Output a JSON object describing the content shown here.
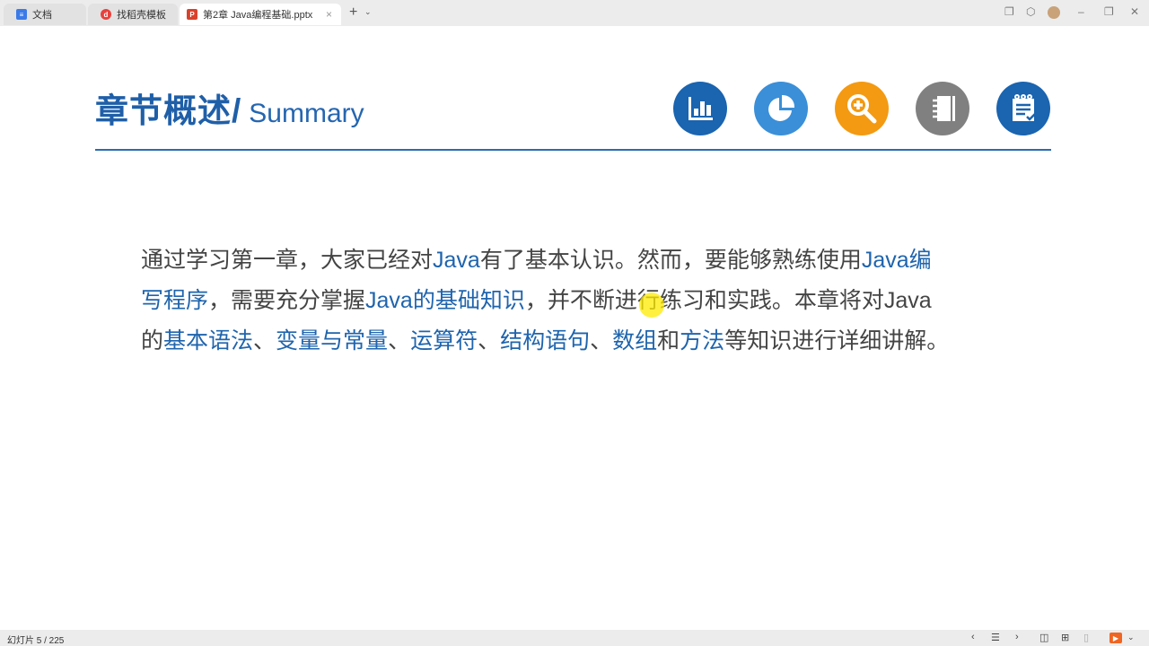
{
  "tabs": [
    {
      "label": "文档",
      "icon": "doc-icon",
      "color": "#3b7be8"
    },
    {
      "label": "找稻壳模板",
      "icon": "docer-icon",
      "color": "#e8413c"
    },
    {
      "label": "第2章 Java编程基础.pptx",
      "icon": "ppt-icon",
      "color": "#d9412b",
      "active": true
    }
  ],
  "tab_close": "×",
  "new_tab": "+",
  "slide": {
    "title_cn": "章节概述/",
    "title_en": "Summary",
    "icons": [
      {
        "name": "bar-chart-icon",
        "color": "#1a64b0"
      },
      {
        "name": "pie-chart-icon",
        "color": "#3a8fd8"
      },
      {
        "name": "zoom-in-icon",
        "color": "#f39a12"
      },
      {
        "name": "notebook-icon",
        "color": "#808080"
      },
      {
        "name": "checklist-icon",
        "color": "#1a64b0"
      }
    ],
    "lines": [
      [
        {
          "t": "通过学习第一章，大家已经对",
          "h": false
        },
        {
          "t": "Java",
          "h": true
        },
        {
          "t": "有了基本认识。然而，要能够熟练使用",
          "h": false
        },
        {
          "t": "Java编",
          "h": true
        }
      ],
      [
        {
          "t": "写程序",
          "h": true
        },
        {
          "t": "，需要充分掌握",
          "h": false
        },
        {
          "t": "Java的基础知识",
          "h": true
        },
        {
          "t": "，并不断进行练习和实践。本章将对Java",
          "h": false
        }
      ],
      [
        {
          "t": "的",
          "h": false
        },
        {
          "t": "基本语法",
          "h": true
        },
        {
          "t": "、",
          "h": false
        },
        {
          "t": "变量与常量",
          "h": true
        },
        {
          "t": "、",
          "h": false
        },
        {
          "t": "运算符",
          "h": true
        },
        {
          "t": "、",
          "h": false
        },
        {
          "t": "结构语句",
          "h": true
        },
        {
          "t": "、",
          "h": false
        },
        {
          "t": "数组",
          "h": true
        },
        {
          "t": "和",
          "h": false
        },
        {
          "t": "方法",
          "h": true
        },
        {
          "t": "等知识进行详细讲解。",
          "h": false
        }
      ]
    ]
  },
  "status": {
    "slide_counter": "幻灯片 5 / 225"
  }
}
